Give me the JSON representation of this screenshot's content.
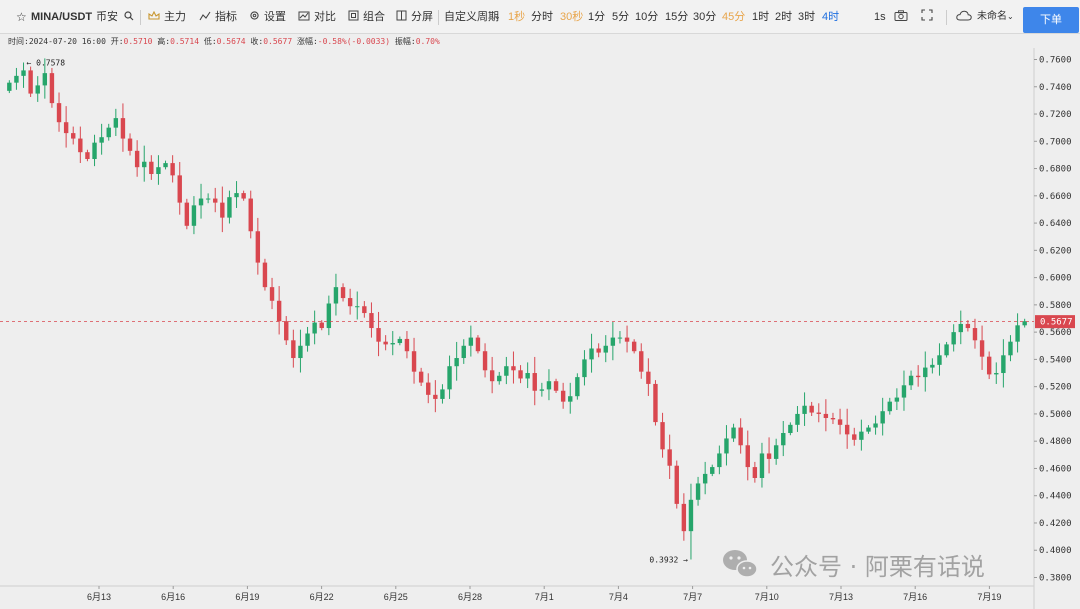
{
  "toolbar": {
    "symbol": "MINA/USDT",
    "exchange": "币安",
    "main_label": "主力",
    "indicator_label": "指标",
    "settings_label": "设置",
    "compare_label": "对比",
    "combo_label": "组合",
    "split_label": "分屏",
    "custom_period_label": "自定义周期",
    "periods": [
      "1秒",
      "分时",
      "30秒",
      "1分",
      "5分",
      "10分",
      "15分",
      "30分",
      "45分",
      "1时",
      "2时",
      "3时",
      "4时"
    ],
    "active_period": "4时",
    "refresh_label": "1s",
    "layout_label": "未命名",
    "order_label": "下单",
    "colors": {
      "up": "#26a56b",
      "down": "#d9474f",
      "active": "#1f6fe0",
      "highlight": "#e8a54b",
      "order_button": "#3e86ea"
    }
  },
  "info": {
    "time_label": "时间:",
    "time_value": "2024-07-20 16:00",
    "open_label": "开:",
    "open_value": "0.5710",
    "high_label": "高:",
    "high_value": "0.5714",
    "low_label": "低:",
    "low_value": "0.5674",
    "close_label": "收:",
    "close_value": "0.5677",
    "change_label": "涨幅:",
    "change_value": "-0.58%(-0.0033)",
    "amplitude_label": "振幅:",
    "amplitude_value": "0.70%"
  },
  "chart_data": {
    "type": "candlestick",
    "x_ticks": [
      "6月13",
      "6月16",
      "6月19",
      "6月22",
      "6月25",
      "6月28",
      "7月1",
      "7月4",
      "7月7",
      "7月10",
      "7月13",
      "7月16",
      "7月19"
    ],
    "y_ticks": [
      "0.7600",
      "0.7400",
      "0.7200",
      "0.7000",
      "0.6800",
      "0.6600",
      "0.6400",
      "0.6200",
      "0.6000",
      "0.5800",
      "0.5600",
      "0.5400",
      "0.5200",
      "0.5000",
      "0.4800",
      "0.4600",
      "0.4400",
      "0.4200",
      "0.4000",
      "0.3800"
    ],
    "ylim": [
      0.3775,
      0.7675
    ],
    "last_price": "0.5677",
    "max_label": "← 0.7578",
    "min_label": "0.3932 →",
    "candle_closes": [
      0.743,
      0.748,
      0.752,
      0.735,
      0.741,
      0.75,
      0.728,
      0.714,
      0.706,
      0.702,
      0.692,
      0.687,
      0.699,
      0.703,
      0.71,
      0.717,
      0.702,
      0.693,
      0.681,
      0.685,
      0.676,
      0.681,
      0.684,
      0.675,
      0.655,
      0.638,
      0.653,
      0.658,
      0.658,
      0.655,
      0.644,
      0.659,
      0.662,
      0.658,
      0.634,
      0.611,
      0.593,
      0.583,
      0.568,
      0.554,
      0.541,
      0.55,
      0.559,
      0.567,
      0.563,
      0.581,
      0.593,
      0.585,
      0.579,
      0.579,
      0.574,
      0.563,
      0.553,
      0.551,
      0.552,
      0.555,
      0.546,
      0.531,
      0.523,
      0.514,
      0.511,
      0.518,
      0.535,
      0.541,
      0.55,
      0.556,
      0.546,
      0.532,
      0.524,
      0.528,
      0.535,
      0.532,
      0.526,
      0.53,
      0.517,
      0.518,
      0.524,
      0.517,
      0.509,
      0.513,
      0.527,
      0.54,
      0.548,
      0.545,
      0.55,
      0.556,
      0.556,
      0.553,
      0.546,
      0.531,
      0.522,
      0.494,
      0.474,
      0.462,
      0.434,
      0.414,
      0.437,
      0.449,
      0.456,
      0.461,
      0.471,
      0.482,
      0.49,
      0.477,
      0.461,
      0.453,
      0.471,
      0.467,
      0.477,
      0.486,
      0.492,
      0.5,
      0.506,
      0.501,
      0.5,
      0.497,
      0.496,
      0.492,
      0.485,
      0.481,
      0.487,
      0.49,
      0.493,
      0.502,
      0.509,
      0.512,
      0.521,
      0.528,
      0.527,
      0.534,
      0.536,
      0.543,
      0.551,
      0.56,
      0.566,
      0.563,
      0.554,
      0.542,
      0.529,
      0.53,
      0.543,
      0.553,
      0.565,
      0.568
    ]
  },
  "watermark": {
    "text": "公众号 · 阿栗有话说"
  }
}
